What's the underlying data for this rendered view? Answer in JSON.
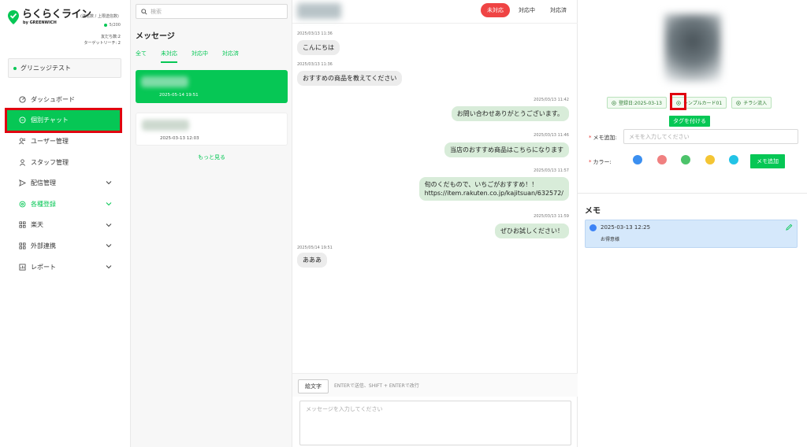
{
  "app": {
    "logo_title": "らくらくライン",
    "logo_sub": "by GREENWICH",
    "logo_note": "(送信数 / 上限送信数)",
    "send_count": "5/200",
    "friends": "友だち数:2",
    "target_reach": "ターゲットリーチ: 2",
    "account_name": "グリニッジテスト"
  },
  "nav": {
    "items": [
      {
        "label": "ダッシュボード",
        "icon": "dashboard-icon"
      },
      {
        "label": "個別チャット",
        "icon": "chat-icon"
      },
      {
        "label": "ユーザー管理",
        "icon": "users-icon"
      },
      {
        "label": "スタッフ管理",
        "icon": "staff-icon"
      },
      {
        "label": "配信管理",
        "icon": "send-icon"
      },
      {
        "label": "各種登録",
        "icon": "settings-icon"
      },
      {
        "label": "楽天",
        "icon": "rakuten-icon"
      },
      {
        "label": "外部連携",
        "icon": "link-icon"
      },
      {
        "label": "レポート",
        "icon": "report-icon"
      }
    ]
  },
  "list": {
    "search_placeholder": "検索",
    "title": "メッセージ",
    "tabs": [
      "全て",
      "未対応",
      "対応中",
      "対応済"
    ],
    "conversations": [
      {
        "time": "2025-05-14 19:51"
      },
      {
        "time": "2025-03-13 12:03"
      }
    ],
    "more_label": "もっと見る"
  },
  "chat": {
    "status_tabs": [
      "未対応",
      "対応中",
      "対応済"
    ],
    "messages": [
      {
        "side": "left",
        "time": "2025/03/13 11:36",
        "text": "こんにちは"
      },
      {
        "side": "left",
        "time": "2025/03/13 11:36",
        "text": "おすすめの商品を教えてください"
      },
      {
        "side": "right",
        "time": "2025/03/13 11:42",
        "text": "お問い合わせありがとうございます。"
      },
      {
        "side": "right",
        "time": "2025/03/13 11:46",
        "text": "当店のおすすめ商品はこちらになります"
      },
      {
        "side": "right",
        "time": "2025/03/13 11:57",
        "text": "旬のくだもので、いちごがおすすめ！！",
        "text2": "https://item.rakuten.co.jp/kajitsuan/632572/"
      },
      {
        "side": "right",
        "time": "2025/03/13 11:59",
        "text": "ぜひお試しください！"
      },
      {
        "side": "left",
        "time": "2025/05/14 19:51",
        "text": "あああ"
      }
    ],
    "emoji_label": "絵文字",
    "hint": "ENTERで送信、SHIFT + ENTERで改行",
    "input_placeholder": "メッセージを入力してください"
  },
  "profile": {
    "tags": [
      "登録日:2025-03-13",
      "シンプルカード01",
      "チラシ流入"
    ],
    "add_tag_label": "タグを付ける",
    "memo_label": "メモ追加:",
    "memo_placeholder": "メモを入力してください",
    "color_label": "カラー:",
    "colors": [
      "#3b8ff0",
      "#f08080",
      "#4cc36a",
      "#f4c534",
      "#22c3e6"
    ],
    "memo_add_label": "メモ追加",
    "memo_section_title": "メモ",
    "memos": [
      {
        "date": "2025-03-13 12:25",
        "body": "お得意様",
        "color": "#3b82f6"
      }
    ]
  },
  "colors": {
    "accent_green": "#06c755",
    "unresolved_red": "#ef4444",
    "highlight_red": "#e0000f"
  }
}
